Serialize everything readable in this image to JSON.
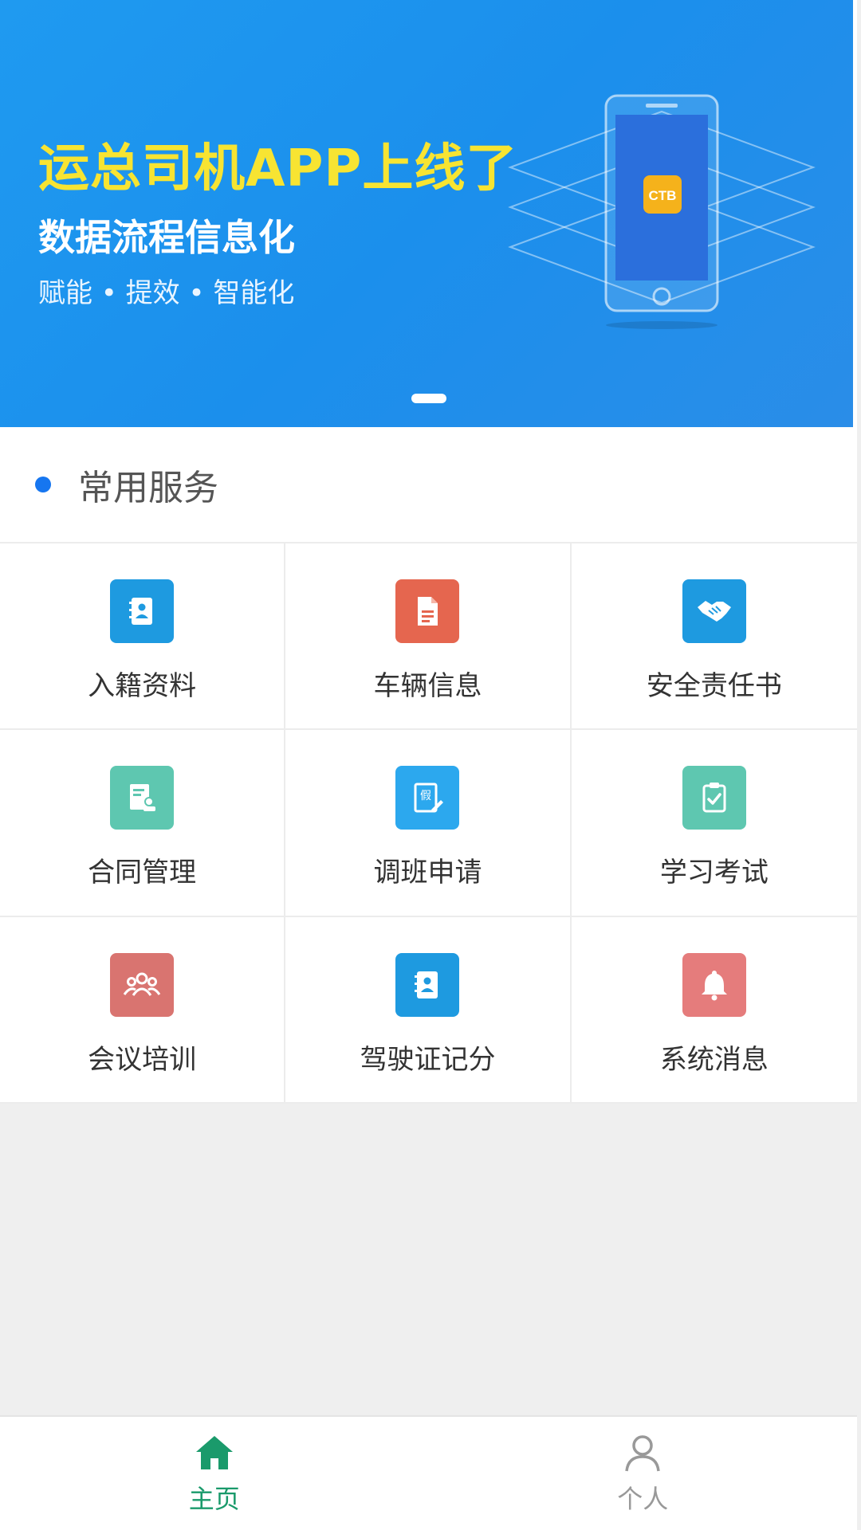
{
  "banner": {
    "title": "运总司机APP上线了",
    "subtitle": "数据流程信息化",
    "tagline": "赋能 • 提效 • 智能化",
    "phone_badge": "CTB"
  },
  "section": {
    "title": "常用服务"
  },
  "services": [
    {
      "label": "入籍资料",
      "icon": "contact-book-icon",
      "color": "#1e9ae0"
    },
    {
      "label": "车辆信息",
      "icon": "document-icon",
      "color": "#e5664f"
    },
    {
      "label": "安全责任书",
      "icon": "handshake-icon",
      "color": "#1e9ae0"
    },
    {
      "label": "合同管理",
      "icon": "contract-icon",
      "color": "#5ec7b0"
    },
    {
      "label": "调班申请",
      "icon": "leave-request-icon",
      "color": "#2ca8ee"
    },
    {
      "label": "学习考试",
      "icon": "clipboard-check-icon",
      "color": "#5ec7b0"
    },
    {
      "label": "会议培训",
      "icon": "group-icon",
      "color": "#d97470"
    },
    {
      "label": "驾驶证记分",
      "icon": "license-book-icon",
      "color": "#1e9ae0"
    },
    {
      "label": "系统消息",
      "icon": "bell-icon",
      "color": "#e57c7c"
    }
  ],
  "nav": {
    "home_label": "主页",
    "profile_label": "个人",
    "active_color": "#1a9a6b",
    "inactive_color": "#999999"
  }
}
